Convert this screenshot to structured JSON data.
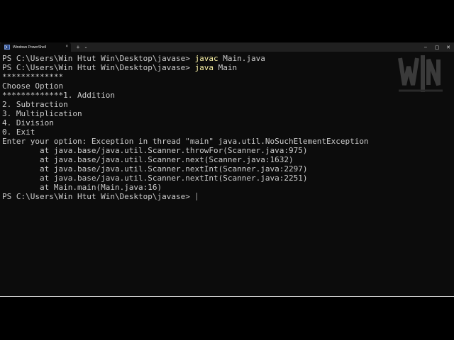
{
  "window": {
    "tab_title": "Windows PowerShell",
    "tab_close": "×",
    "new_tab": "+",
    "dropdown": "⌄",
    "minimize": "–",
    "maximize": "▢",
    "close": "✕"
  },
  "watermark": {
    "text": "WIN",
    "icon": "win-logo-watermark"
  },
  "terminal": {
    "lines": [
      {
        "prompt": "PS C:\\Users\\Win Htut Win\\Desktop\\javase> ",
        "command": "javac",
        "args": " Main.java"
      },
      {
        "prompt": "PS C:\\Users\\Win Htut Win\\Desktop\\javase> ",
        "command": "java",
        "args": " Main"
      },
      {
        "text": "*************"
      },
      {
        "text": "Choose Option"
      },
      {
        "text": "*************1. Addition"
      },
      {
        "text": "2. Subtraction"
      },
      {
        "text": "3. Multiplication"
      },
      {
        "text": "4. Division"
      },
      {
        "text": "0. Exit"
      },
      {
        "text": "Enter your option: Exception in thread \"main\" java.util.NoSuchElementException"
      },
      {
        "text": "        at java.base/java.util.Scanner.throwFor(Scanner.java:975)"
      },
      {
        "text": "        at java.base/java.util.Scanner.next(Scanner.java:1632)"
      },
      {
        "text": "        at java.base/java.util.Scanner.nextInt(Scanner.java:2297)"
      },
      {
        "text": "        at java.base/java.util.Scanner.nextInt(Scanner.java:2251)"
      },
      {
        "text": "        at Main.main(Main.java:16)"
      },
      {
        "prompt": "PS C:\\Users\\Win Htut Win\\Desktop\\javase> "
      }
    ]
  },
  "colors": {
    "terminal_bg": "#0c0c0c",
    "text": "#cccccc",
    "command": "#f9f1a5",
    "titlebar": "#202020"
  }
}
